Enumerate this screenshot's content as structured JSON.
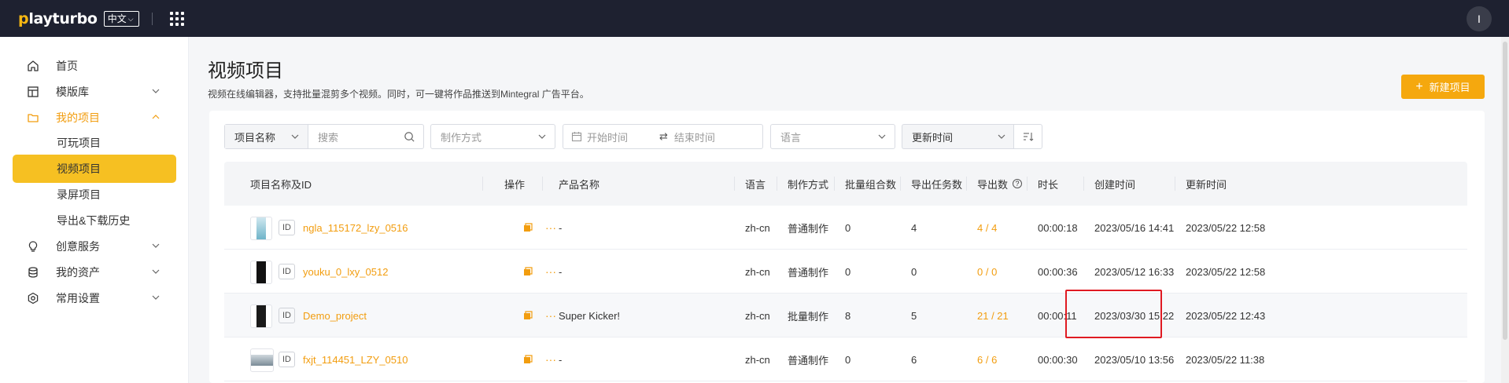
{
  "topbar": {
    "logo_prefix": "p",
    "logo_rest": "layturbo",
    "language": "中文",
    "avatar_letter": "I"
  },
  "sidebar": {
    "items": [
      {
        "label": "首页",
        "icon": "home-icon"
      },
      {
        "label": "模版库",
        "icon": "template-icon"
      },
      {
        "label": "我的项目",
        "icon": "folder-icon"
      },
      {
        "label": "可玩项目"
      },
      {
        "label": "视频项目"
      },
      {
        "label": "录屏项目"
      },
      {
        "label": "导出&下载历史"
      },
      {
        "label": "创意服务",
        "icon": "bulb-icon"
      },
      {
        "label": "我的资产",
        "icon": "database-icon"
      },
      {
        "label": "常用设置",
        "icon": "settings-icon"
      }
    ],
    "active_item": "视频项目",
    "accent_color": "#f6c022"
  },
  "page": {
    "title": "视频项目",
    "description": "视频在线编辑器，支持批量混剪多个视频。同时，可一键将作品推送到Mintegral 广告平台。",
    "new_button": "新建项目"
  },
  "filters": {
    "name_selector": "项目名称",
    "search_placeholder": "搜索",
    "method_placeholder": "制作方式",
    "start_time_placeholder": "开始时间",
    "end_time_placeholder": "结束时间",
    "language_placeholder": "语言",
    "sort_selector": "更新时间"
  },
  "table": {
    "headers": {
      "name": "项目名称及ID",
      "actions": "操作",
      "product": "产品名称",
      "language": "语言",
      "method": "制作方式",
      "combos": "批量组合数",
      "tasks": "导出任务数",
      "exports": "导出数",
      "duration": "时长",
      "created": "创建时间",
      "updated": "更新时间"
    },
    "id_badge": "ID",
    "rows": [
      {
        "name": "ngla_115172_lzy_0516",
        "product": "-",
        "language": "zh-cn",
        "method": "普通制作",
        "combos": "0",
        "tasks": "4",
        "exports": "4 / 4",
        "duration": "00:00:18",
        "created": "2023/05/16 14:41",
        "updated": "2023/05/22 12:58",
        "thumb": "#6fb4c9"
      },
      {
        "name": "youku_0_lxy_0512",
        "product": "-",
        "language": "zh-cn",
        "method": "普通制作",
        "combos": "0",
        "tasks": "0",
        "exports": "0 / 0",
        "duration": "00:00:36",
        "created": "2023/05/12 16:33",
        "updated": "2023/05/22 12:58",
        "thumb": "#111111"
      },
      {
        "name": "Demo_project",
        "product": "Super Kicker!",
        "language": "zh-cn",
        "method": "批量制作",
        "combos": "8",
        "tasks": "5",
        "exports": "21 / 21",
        "duration": "00:00:11",
        "created": "2023/03/30 15:22",
        "updated": "2023/05/22 12:43",
        "thumb": "#1a1a1a"
      },
      {
        "name": "fxjt_114451_LZY_0510",
        "product": "-",
        "language": "zh-cn",
        "method": "普通制作",
        "combos": "0",
        "tasks": "6",
        "exports": "6 / 6",
        "duration": "00:00:30",
        "created": "2023/05/10 13:56",
        "updated": "2023/05/22 11:38",
        "thumb": "#8a9aa6"
      }
    ]
  }
}
